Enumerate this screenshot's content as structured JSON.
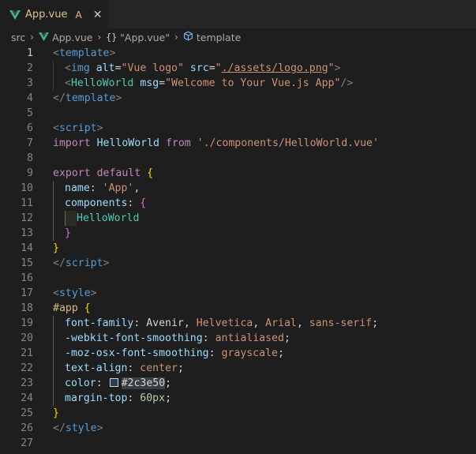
{
  "tab": {
    "label": "App.vue",
    "badge": "A",
    "close": "✕"
  },
  "breadcrumb": {
    "folder": "src",
    "file": "App.vue",
    "braces": "{}",
    "object": "\"App.vue\"",
    "symbol": "template"
  },
  "lines": [
    "1",
    "2",
    "3",
    "4",
    "5",
    "6",
    "7",
    "8",
    "9",
    "10",
    "11",
    "12",
    "13",
    "14",
    "15",
    "16",
    "17",
    "18",
    "19",
    "20",
    "21",
    "22",
    "23",
    "24",
    "25",
    "26",
    "27"
  ],
  "code": {
    "l1": [
      "<",
      "template",
      ">"
    ],
    "l2": [
      "<",
      "img",
      " ",
      "alt",
      "=",
      "\"Vue logo\"",
      " ",
      "src",
      "=",
      "\"",
      "./assets/logo.png",
      "\"",
      ">"
    ],
    "l3": [
      "<",
      "HelloWorld",
      " ",
      "msg",
      "=",
      "\"Welcome to Your Vue.js App\"",
      "/>"
    ],
    "l4": [
      "</",
      "template",
      ">"
    ],
    "l6": [
      "<",
      "script",
      ">"
    ],
    "l7": [
      "import",
      " ",
      "HelloWorld",
      " ",
      "from",
      " ",
      "'./components/HelloWorld.vue'"
    ],
    "l9": [
      "export",
      " ",
      "default",
      " ",
      "{"
    ],
    "l10": [
      "name",
      ": ",
      "'App'",
      ","
    ],
    "l11": [
      "components",
      ": ",
      "{"
    ],
    "l12": [
      "HelloWorld"
    ],
    "l13": [
      "}"
    ],
    "l14": [
      "}"
    ],
    "l15": [
      "</",
      "script",
      ">"
    ],
    "l17": [
      "<",
      "style",
      ">"
    ],
    "l18": [
      "#app",
      " ",
      "{"
    ],
    "l19": [
      "font-family",
      ": ",
      "Avenir",
      ", ",
      "Helvetica",
      ", ",
      "Arial",
      ", ",
      "sans-serif",
      ";"
    ],
    "l20": [
      "-webkit-font-smoothing",
      ": ",
      "antialiased",
      ";"
    ],
    "l21": [
      "-moz-osx-font-smoothing",
      ": ",
      "grayscale",
      ";"
    ],
    "l22": [
      "text-align",
      ": ",
      "center",
      ";"
    ],
    "l23": [
      "color",
      ": ",
      "#2c3e50",
      ";"
    ],
    "l24": [
      "margin-top",
      ": ",
      "60px",
      ";"
    ],
    "l25": [
      "}"
    ],
    "l26": [
      "</",
      "style",
      ">"
    ]
  },
  "colors": {
    "vue_green": "#41b883",
    "vue_dark": "#35495e",
    "swatch": "#2c3e50"
  },
  "icons": {
    "file_icon": "vue-icon",
    "symbol_icon": "cube-icon"
  }
}
